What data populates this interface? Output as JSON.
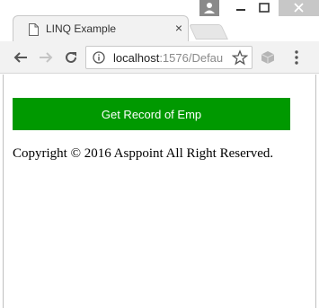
{
  "browser": {
    "tab_title": "LINQ Example",
    "tab_close_glyph": "×",
    "url_host": "localhost",
    "url_rest": ":1576/Defau",
    "icons": {
      "tab": "page-icon",
      "back": "arrow-left-icon",
      "forward": "arrow-right-icon",
      "reload": "reload-icon",
      "info": "info-icon",
      "star": "star-icon",
      "extension": "extension-icon",
      "menu": "kebab-menu-icon",
      "user": "user-icon",
      "minimize": "minimize-icon",
      "maximize": "maximize-icon",
      "close": "close-icon"
    }
  },
  "page": {
    "button_label": "Get Record of Emp",
    "copyright": "Copyright © 2016 Asppoint All Right Reserved."
  },
  "colors": {
    "button_bg": "#009900",
    "button_text": "#ffffff"
  }
}
